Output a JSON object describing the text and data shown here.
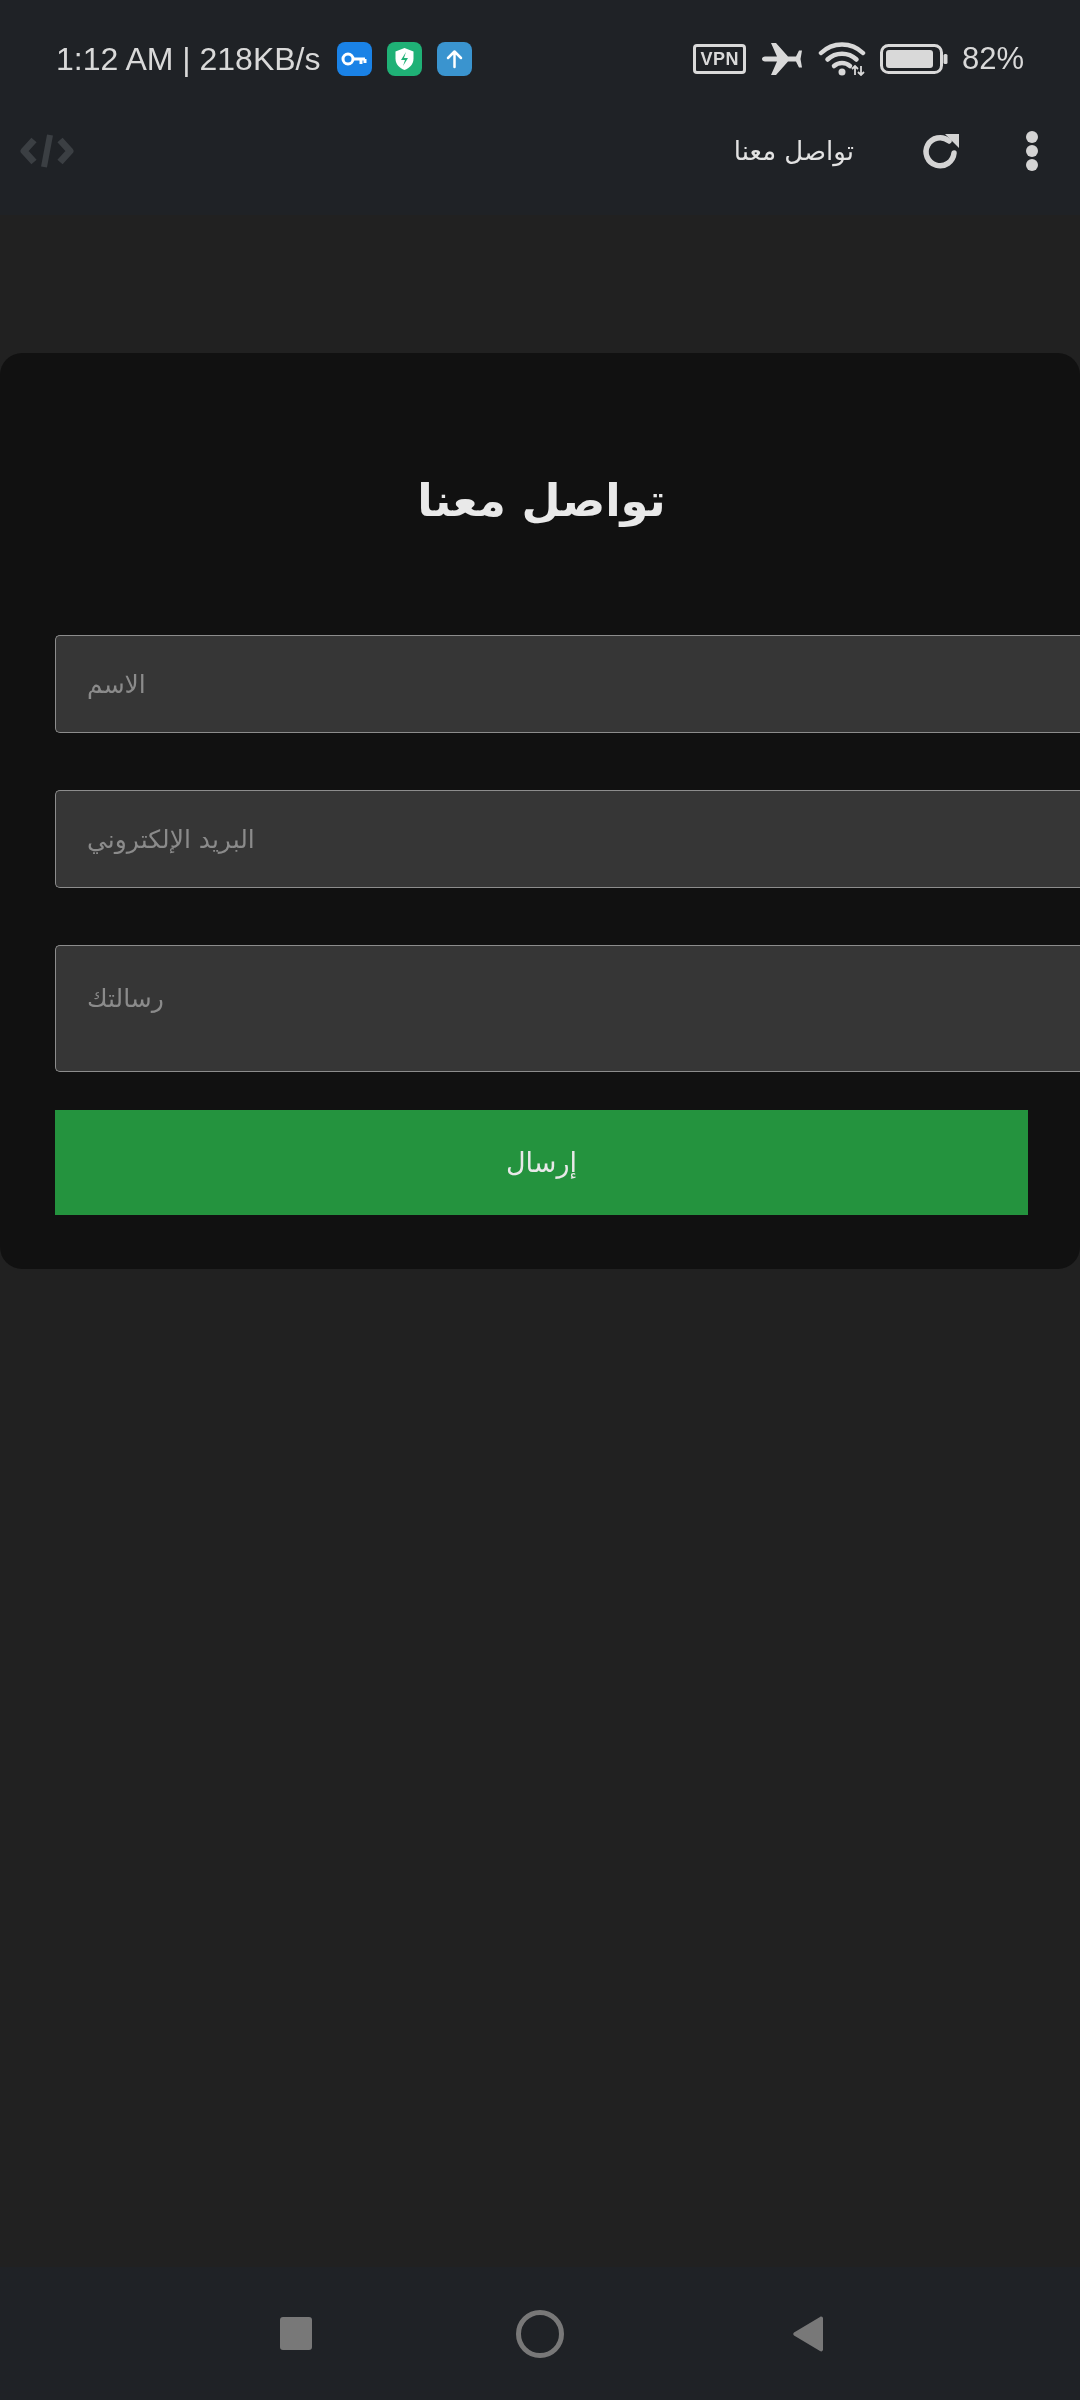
{
  "status_bar": {
    "time": "1:12 AM | 218KB/s",
    "vpn_badge": "VPN",
    "battery": "82%"
  },
  "app_bar": {
    "title": "تواصل معنا"
  },
  "form": {
    "title": "تواصل معنا",
    "fields": [
      {
        "kind": "input",
        "placeholder": "الاسم"
      },
      {
        "kind": "input",
        "placeholder": "البريد الإلكتروني"
      },
      {
        "kind": "textarea",
        "placeholder": "رسالتك"
      }
    ],
    "submit_button": "إرسال"
  }
}
